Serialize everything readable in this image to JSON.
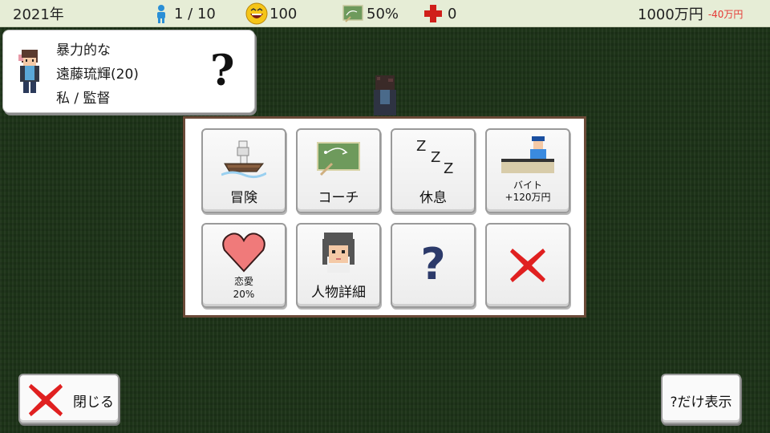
{
  "status_bar": {
    "year": "2021年",
    "members": "1 / 10",
    "happiness": "100",
    "progress": "50%",
    "injuries": "0",
    "money": "1000万円",
    "money_delta": "-40万円"
  },
  "character": {
    "trait": "暴力的な",
    "name_age": "遠藤琉輝(20)",
    "role": "私 / 監督",
    "unknown_mark": "?"
  },
  "menu": {
    "adventure": "冒険",
    "coach": "コーチ",
    "rest": "休息",
    "part_time_line1": "バイト",
    "part_time_line2": "+120万円",
    "romance_line1": "恋愛",
    "romance_line2": "20%",
    "person_detail": "人物詳細",
    "unknown": "?",
    "rest_z": "Z"
  },
  "bottom": {
    "close_label": "閉じる",
    "only_q_label": "?だけ表示"
  },
  "colors": {
    "accent_red": "#e02020",
    "status_negative": "#e53935",
    "board_green": "#6e9a5c",
    "question_blue": "#2c3a6a"
  }
}
